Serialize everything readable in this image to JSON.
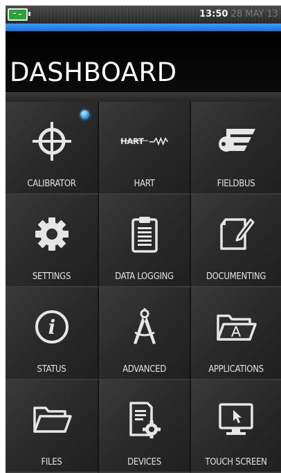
{
  "status_bar": {
    "time": "13:50",
    "date": "28 MAY 13",
    "battery_icon": "battery-charging-icon"
  },
  "header": {
    "title": "DASHBOARD"
  },
  "tiles": [
    {
      "label": "CALIBRATOR",
      "icon": "crosshair-icon",
      "indicator": true
    },
    {
      "label": "HART",
      "icon": "hart-logo-icon"
    },
    {
      "label": "FIELDBUS",
      "icon": "fieldbus-icon"
    },
    {
      "label": "SETTINGS",
      "icon": "gear-icon"
    },
    {
      "label": "DATA LOGGING",
      "icon": "clipboard-icon"
    },
    {
      "label": "DOCUMENTING",
      "icon": "document-pen-icon"
    },
    {
      "label": "STATUS",
      "icon": "info-icon"
    },
    {
      "label": "ADVANCED",
      "icon": "compass-icon"
    },
    {
      "label": "APPLICATIONS",
      "icon": "folder-app-icon"
    },
    {
      "label": "FILES",
      "icon": "folder-icon"
    },
    {
      "label": "DEVICES",
      "icon": "device-gear-icon"
    },
    {
      "label": "TOUCH SCREEN",
      "icon": "monitor-cursor-icon"
    }
  ],
  "colors": {
    "accent_blue": "#2a86f0",
    "indicator_blue": "#2e9ad6",
    "battery_green": "#2aa23a"
  }
}
